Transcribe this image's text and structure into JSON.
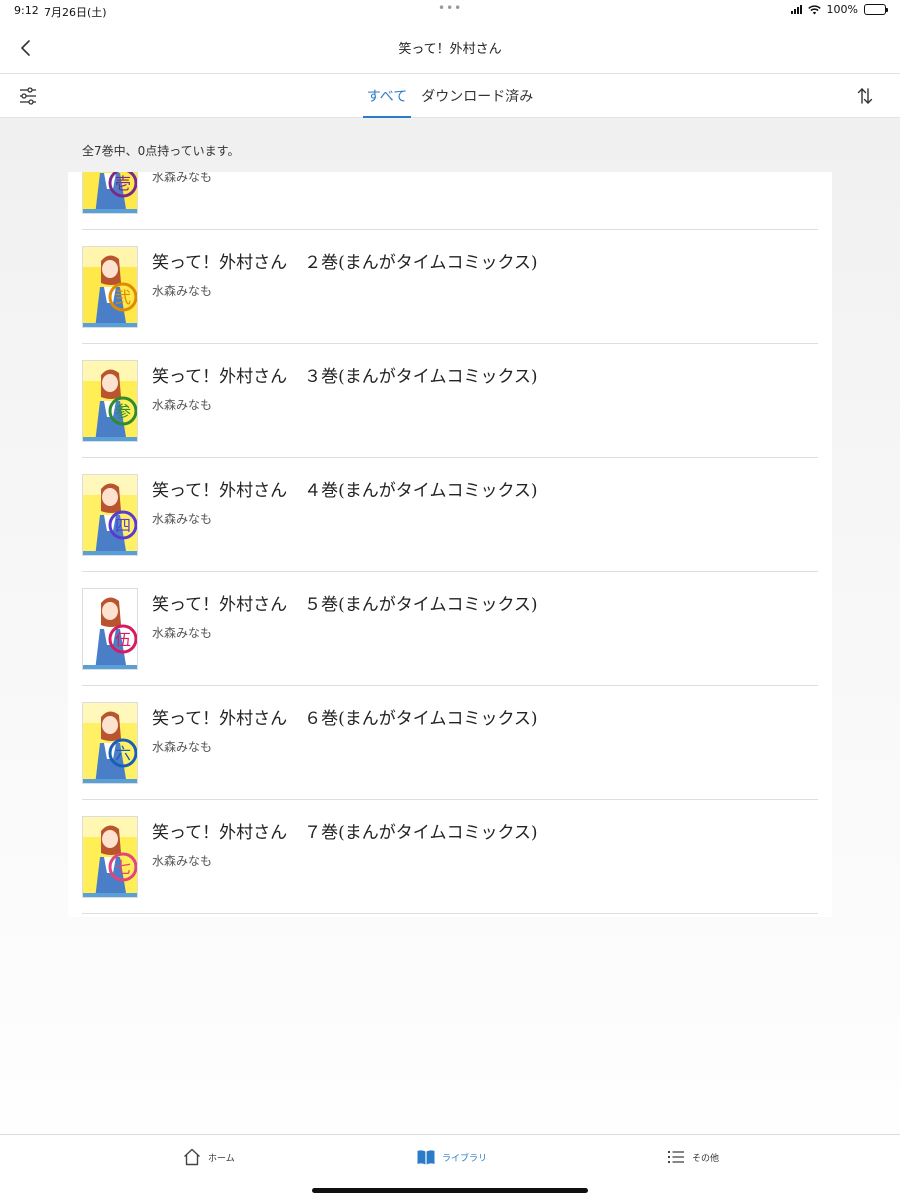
{
  "status_bar": {
    "time": "9:12",
    "date": "7月26日(土)",
    "dots": "•••",
    "battery_percent": "100%",
    "battery_level": 1.0
  },
  "nav": {
    "title": "笑って！外村さん"
  },
  "tabs": [
    {
      "label": "すべて",
      "active": true
    },
    {
      "label": "ダウンロード済み",
      "active": false
    }
  ],
  "summary": {
    "count_text": "全7巻中、0点持っています。"
  },
  "books": [
    {
      "title": "",
      "author": "水森みなも",
      "cover_mark": "壱",
      "cover_color": "#7a2a8a",
      "cover_bg": "#ffe94a",
      "partial": true
    },
    {
      "title": "笑って！外村さん　２巻(まんがタイムコミックス)",
      "author": "水森みなも",
      "cover_mark": "弐",
      "cover_color": "#e08a00",
      "cover_bg": "#ffe94a"
    },
    {
      "title": "笑って！外村さん　３巻(まんがタイムコミックス)",
      "author": "水森みなも",
      "cover_mark": "参",
      "cover_color": "#2e8b2e",
      "cover_bg": "#ffee55"
    },
    {
      "title": "笑って！外村さん　４巻(まんがタイムコミックス)",
      "author": "水森みなも",
      "cover_mark": "四",
      "cover_color": "#5a3bd0",
      "cover_bg": "#fff066"
    },
    {
      "title": "笑って！外村さん　５巻(まんがタイムコミックス)",
      "author": "水森みなも",
      "cover_mark": "伍",
      "cover_color": "#d81b60",
      "cover_bg": "#ffffff"
    },
    {
      "title": "笑って！外村さん　６巻(まんがタイムコミックス)",
      "author": "水森みなも",
      "cover_mark": "六",
      "cover_color": "#1a5fb4",
      "cover_bg": "#fff066"
    },
    {
      "title": "笑って！外村さん　７巻(まんがタイムコミックス)",
      "author": "水森みなも",
      "cover_mark": "七",
      "cover_color": "#e0457b",
      "cover_bg": "#ffee55"
    }
  ],
  "bottom_nav": [
    {
      "label": "ホーム",
      "icon": "home-icon",
      "active": false
    },
    {
      "label": "ライブラリ",
      "icon": "book-icon",
      "active": true
    },
    {
      "label": "その他",
      "icon": "list-icon",
      "active": false
    }
  ],
  "colors": {
    "accent": "#2b7bc8"
  }
}
